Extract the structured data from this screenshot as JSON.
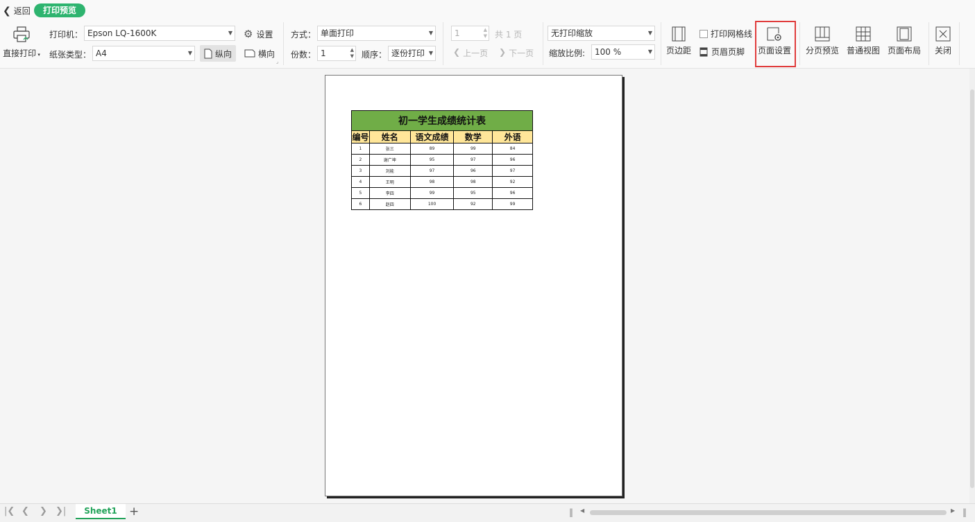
{
  "header": {
    "back_label": "返回",
    "mode_badge": "打印预览"
  },
  "print": {
    "direct_print_label": "直接打印",
    "printer_label": "打印机：",
    "printer_value": "Epson LQ-1600K",
    "settings_label": "设置",
    "paper_label": "纸张类型：",
    "paper_value": "A4",
    "portrait_label": "纵向",
    "landscape_label": "横向",
    "orientation_selected": "纵向"
  },
  "mode": {
    "method_label": "方式：",
    "method_value": "单面打印",
    "copies_label": "份数：",
    "copies_value": "1",
    "order_label": "顺序：",
    "order_value": "逐份打印"
  },
  "paging": {
    "current_page": "1",
    "total_pages": "共 1 页",
    "prev_label": "上一页",
    "next_label": "下一页"
  },
  "scale": {
    "scale_mode_value": "无打印缩放",
    "ratio_label": "缩放比例:",
    "ratio_value": "100 %"
  },
  "tools": {
    "margin_label": "页边距",
    "gridlines_label": "打印网格线",
    "header_footer_label": "页眉页脚",
    "page_setup_label": "页面设置",
    "page_break_label": "分页预览",
    "normal_view_label": "普通视图",
    "page_layout_label": "页面布局",
    "close_label": "关闭"
  },
  "sheet": {
    "title": "初一学生成绩统计表",
    "columns": [
      "编号",
      "姓名",
      "语文成绩",
      "数学",
      "外语"
    ],
    "rows": [
      [
        "1",
        "张三",
        "89",
        "99",
        "84"
      ],
      [
        "2",
        "谢广坤",
        "95",
        "97",
        "96"
      ],
      [
        "3",
        "刘能",
        "97",
        "96",
        "97"
      ],
      [
        "4",
        "王明",
        "98",
        "98",
        "92"
      ],
      [
        "5",
        "李四",
        "99",
        "95",
        "96"
      ],
      [
        "6",
        "赵四",
        "100",
        "92",
        "99"
      ]
    ]
  },
  "bottom": {
    "sheet_tab": "Sheet1"
  },
  "colors": {
    "accent": "#2eb46f",
    "title_fill": "#70ad47",
    "header_fill": "#ffe699",
    "highlight": "#e03b3b"
  }
}
